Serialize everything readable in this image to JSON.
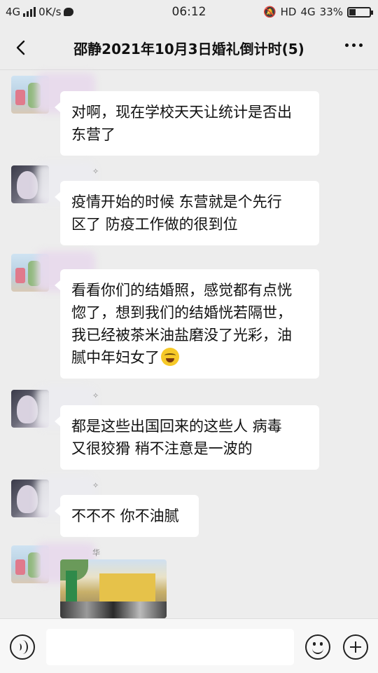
{
  "status_bar": {
    "network": "4G",
    "speed": "0K/s",
    "time": "06:12",
    "hd": "HD",
    "network_right": "4G",
    "battery": "33%",
    "battery_level": 0.33
  },
  "header": {
    "title": "邵静2021年10月3日婚礼倒计时(5)"
  },
  "messages": [
    {
      "lines": [
        "对啊，现在学校天天让统计是否出",
        "东营了"
      ]
    },
    {
      "lines": [
        "疫情开始的时候 东营就是个先行",
        "区了 防疫工作做的很到位"
      ]
    },
    {
      "lines": [
        "看看你们的结婚照，感觉都有点恍",
        "惚了，想到我们的结婚恍若隔世，",
        "我已经被茶米油盐磨没了光彩，油",
        "腻中年妇女了"
      ],
      "emoji": "facepalm-cry-emoji"
    },
    {
      "lines": [
        "都是这些出国回来的这些人 病毒",
        "又很狡猾 稍不注意是一波的"
      ]
    },
    {
      "lines": [
        "不不不 你不油腻"
      ]
    }
  ],
  "name_marks": [
    "✧",
    "✧",
    "✧",
    "✧",
    "华"
  ],
  "input": {
    "value": "",
    "placeholder": ""
  },
  "icons": {
    "back": "chevron-left-icon",
    "more": "ellipsis-icon",
    "voice": "voice-icon",
    "emoji": "emoji-icon",
    "plus": "plus-icon"
  }
}
